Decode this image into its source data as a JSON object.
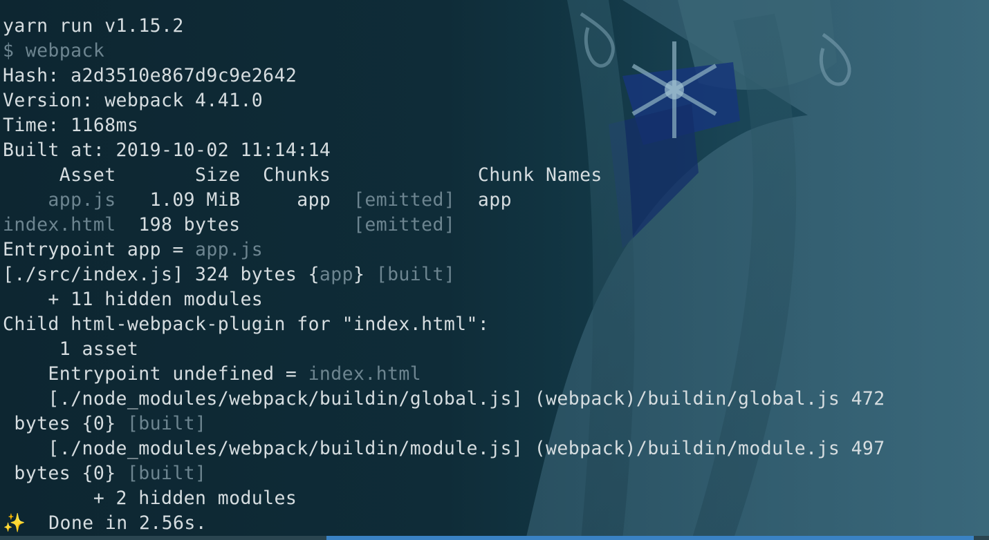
{
  "terminal": {
    "lines": [
      {
        "parts": [
          {
            "text": "yarn run v1.15.2",
            "style": "white"
          }
        ]
      },
      {
        "parts": [
          {
            "text": "$ webpack",
            "style": "dim"
          }
        ]
      },
      {
        "parts": [
          {
            "text": "Hash: a2d3510e867d9c9e2642",
            "style": "white"
          }
        ]
      },
      {
        "parts": [
          {
            "text": "Version: webpack 4.41.0",
            "style": "white"
          }
        ]
      },
      {
        "parts": [
          {
            "text": "Time: 1168ms",
            "style": "white"
          }
        ]
      },
      {
        "parts": [
          {
            "text": "Built at: 2019-10-02 11:14:14",
            "style": "white"
          }
        ]
      },
      {
        "parts": [
          {
            "text": "     Asset       Size  Chunks             Chunk Names",
            "style": "white"
          }
        ]
      },
      {
        "parts": [
          {
            "text": "    app.js",
            "style": "dim"
          },
          {
            "text": "   1.09 MiB     app  ",
            "style": "white"
          },
          {
            "text": "[emitted]",
            "style": "dim"
          },
          {
            "text": "  app",
            "style": "white"
          }
        ]
      },
      {
        "parts": [
          {
            "text": "index.html",
            "style": "dim"
          },
          {
            "text": "  198 bytes          ",
            "style": "white"
          },
          {
            "text": "[emitted]",
            "style": "dim"
          }
        ]
      },
      {
        "parts": [
          {
            "text": "Entrypoint app = ",
            "style": "white"
          },
          {
            "text": "app.js",
            "style": "dim"
          }
        ]
      },
      {
        "parts": [
          {
            "text": "[./src/index.js] 324 bytes {",
            "style": "white"
          },
          {
            "text": "app",
            "style": "dim"
          },
          {
            "text": "} ",
            "style": "white"
          },
          {
            "text": "[built]",
            "style": "dim"
          }
        ]
      },
      {
        "parts": [
          {
            "text": "    + 11 hidden modules",
            "style": "white"
          }
        ]
      },
      {
        "parts": [
          {
            "text": "Child html-webpack-plugin for \"index.html\":",
            "style": "white"
          }
        ]
      },
      {
        "parts": [
          {
            "text": "     1 asset",
            "style": "white"
          }
        ]
      },
      {
        "parts": [
          {
            "text": "    Entrypoint undefined = ",
            "style": "white"
          },
          {
            "text": "index.html",
            "style": "dim"
          }
        ]
      },
      {
        "parts": [
          {
            "text": "    [./node_modules/webpack/buildin/global.js] (webpack)/buildin/global.js 472",
            "style": "white"
          }
        ]
      },
      {
        "parts": [
          {
            "text": " bytes {0} ",
            "style": "white"
          },
          {
            "text": "[built]",
            "style": "dim"
          }
        ]
      },
      {
        "parts": [
          {
            "text": "    [./node_modules/webpack/buildin/module.js] (webpack)/buildin/module.js 497",
            "style": "white"
          }
        ]
      },
      {
        "parts": [
          {
            "text": " bytes {0} ",
            "style": "white"
          },
          {
            "text": "[built]",
            "style": "dim"
          }
        ]
      },
      {
        "parts": [
          {
            "text": "        + 2 hidden modules",
            "style": "white"
          }
        ]
      },
      {
        "parts": [
          {
            "text": "✨",
            "style": "sparkle"
          },
          {
            "text": "  Done in 2.56s.",
            "style": "white"
          }
        ]
      }
    ]
  },
  "colors": {
    "text": "#d6dde0",
    "dim_text": "#6d8590",
    "background": "#0e2a36",
    "scrollbar_thumb": "#3a82c4"
  },
  "icons": {
    "sparkle": "sparkles-icon"
  }
}
